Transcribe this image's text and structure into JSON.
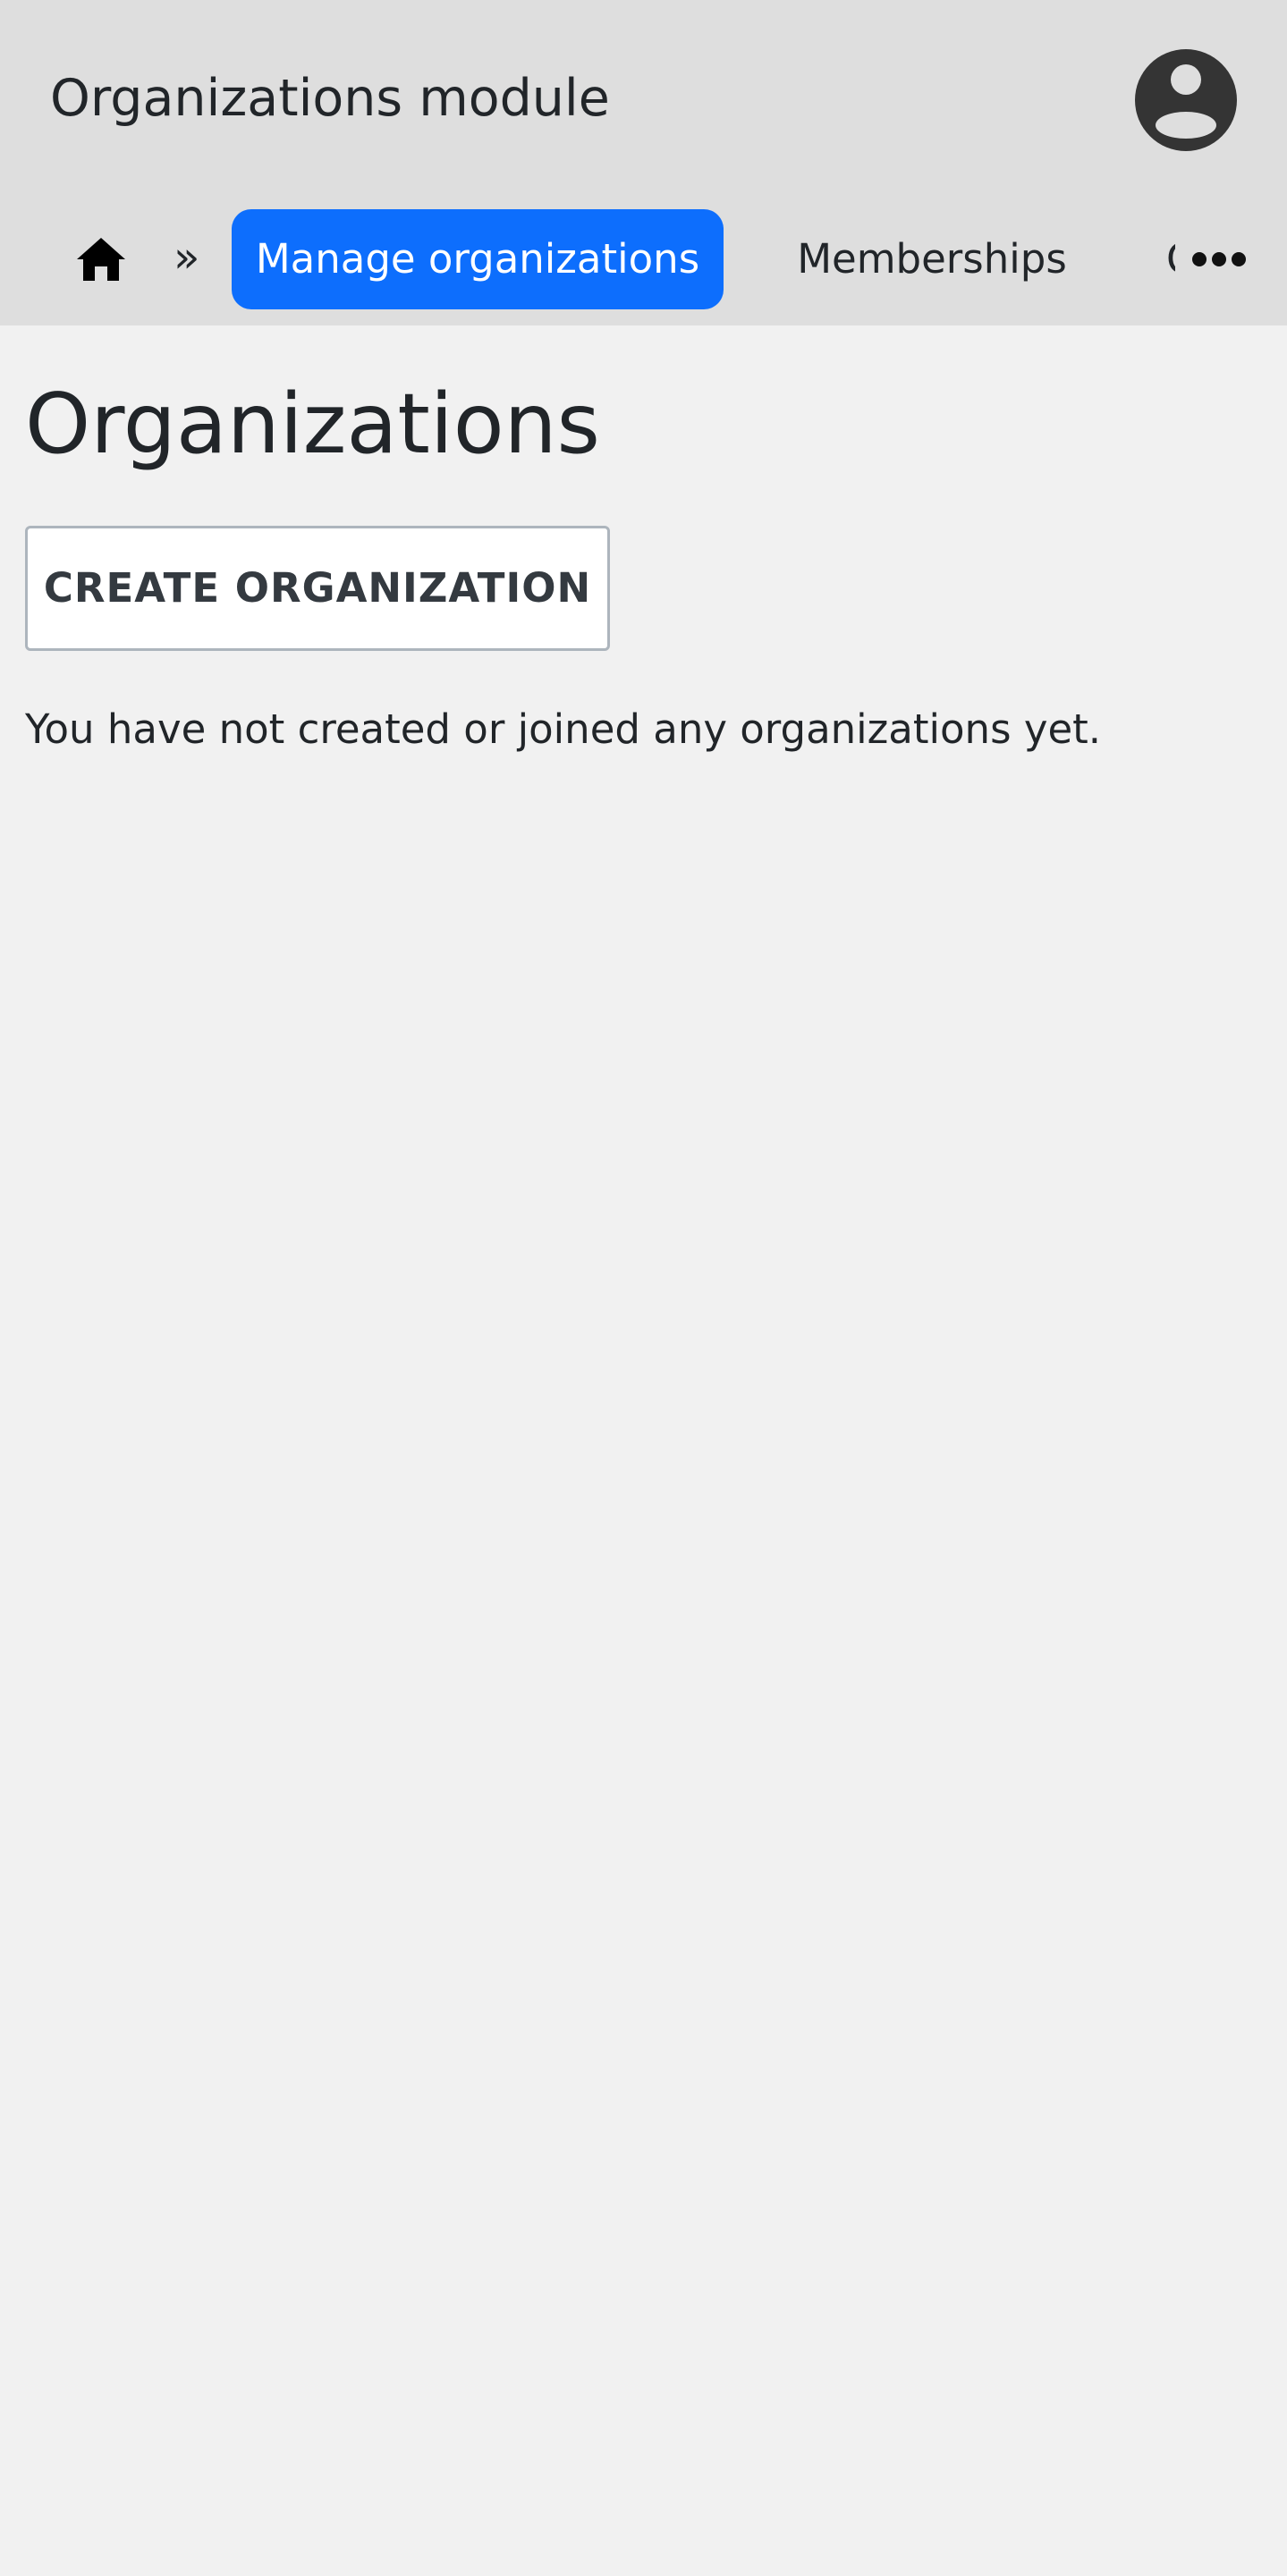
{
  "header": {
    "title": "Organizations module",
    "avatar_icon": "user-avatar-icon"
  },
  "nav": {
    "home_icon": "home-icon",
    "separator": "»",
    "tabs": [
      {
        "label": "Manage organizations",
        "active": true
      },
      {
        "label": "Memberships",
        "active": false
      },
      {
        "label": "O",
        "active": false
      }
    ],
    "more_icon": "more-horizontal-icon"
  },
  "main": {
    "title": "Organizations",
    "create_button_label": "CREATE ORGANIZATION",
    "empty_message": "You have not created or joined any organizations yet."
  },
  "colors": {
    "accent": "#0d6efd",
    "header_bg": "#dedede",
    "page_bg": "#f1f1f1"
  }
}
